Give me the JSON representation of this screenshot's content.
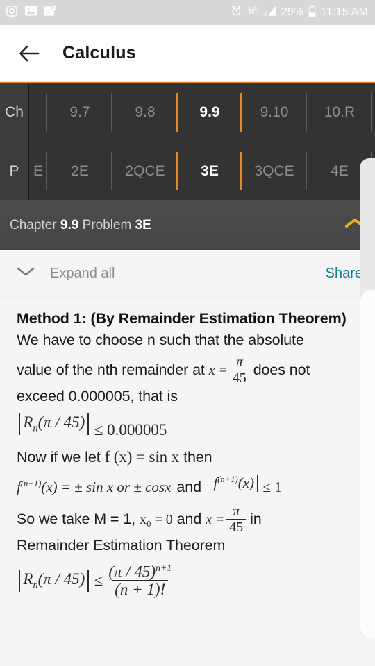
{
  "status_bar": {
    "left_icons": [
      "instagram-icon",
      "gallery-icon",
      "maps-icon"
    ],
    "right_icons": [
      "alarm-icon",
      "data-transfer-icon",
      "signal-icon"
    ],
    "battery_percent": "29%",
    "time": "11:15 AM"
  },
  "app_bar": {
    "back_icon": "back-arrow-icon",
    "title": "Calculus"
  },
  "tabs": {
    "chapter_row_label": "Ch",
    "problem_row_label": "P",
    "chapters": [
      {
        "label": "9.7",
        "selected": false
      },
      {
        "label": "9.8",
        "selected": false
      },
      {
        "label": "9.9",
        "selected": true
      },
      {
        "label": "9.10",
        "selected": false
      },
      {
        "label": "10.R",
        "selected": false
      }
    ],
    "problems": [
      {
        "label": "E",
        "selected": false
      },
      {
        "label": "2E",
        "selected": false
      },
      {
        "label": "2QCE",
        "selected": false
      },
      {
        "label": "3E",
        "selected": true
      },
      {
        "label": "3QCE",
        "selected": false
      },
      {
        "label": "4E",
        "selected": false
      }
    ],
    "accent_color": "#e8862a"
  },
  "breadcrumb": {
    "chapter_word": "Chapter ",
    "chapter_value": "9.9",
    "problem_word": " Problem ",
    "problem_value": "3E",
    "collapse_icon": "chevron-up-icon",
    "collapse_icon_color": "#f0b21b"
  },
  "toolbar": {
    "expand_icon": "chevron-down-icon",
    "expand_label": "Expand all",
    "share_label": "Share",
    "share_color": "#10848c"
  },
  "solution": {
    "heading": "Method 1: (By Remainder Estimation Theorem)",
    "line1": "We have to choose n such that the absolute",
    "line2_a": "value of the nth remainder at",
    "eq_x_num": "π",
    "eq_x_den": "45",
    "eq_x_lhs": "x =",
    "line2_b": "does not",
    "line3": "exceed 0.000005, that is",
    "eq1_R": "R",
    "eq1_sub": "n",
    "eq1_arg": "(π / 45)",
    "eq1_rel": "≤ 0.000005",
    "line4_a": "Now if we let",
    "eq_f": "f (x) = sin x",
    "line4_b": "then",
    "eq2_lhs": "f",
    "eq2_sup": "(n+1)",
    "eq2_rest": "(x) = ± sin x  or  ± cosx",
    "line5_and": "and",
    "eq3_lhs": "f",
    "eq3_sup": "(n+1)",
    "eq3_arg": "(x)",
    "eq3_rel": "≤ 1",
    "line6_a": "So we take M = 1,",
    "eq_x0": "x₀ = 0",
    "line6_b": "and",
    "line6_c": "in",
    "line7": "Remainder Estimation Theorem",
    "eq4_R": "R",
    "eq4_sub": "n",
    "eq4_arg": "(π / 45)",
    "eq4_rel": "≤",
    "eq4_num": "(π / 45)",
    "eq4_num_sup": "n+1",
    "eq4_den": "(n + 1)!"
  }
}
